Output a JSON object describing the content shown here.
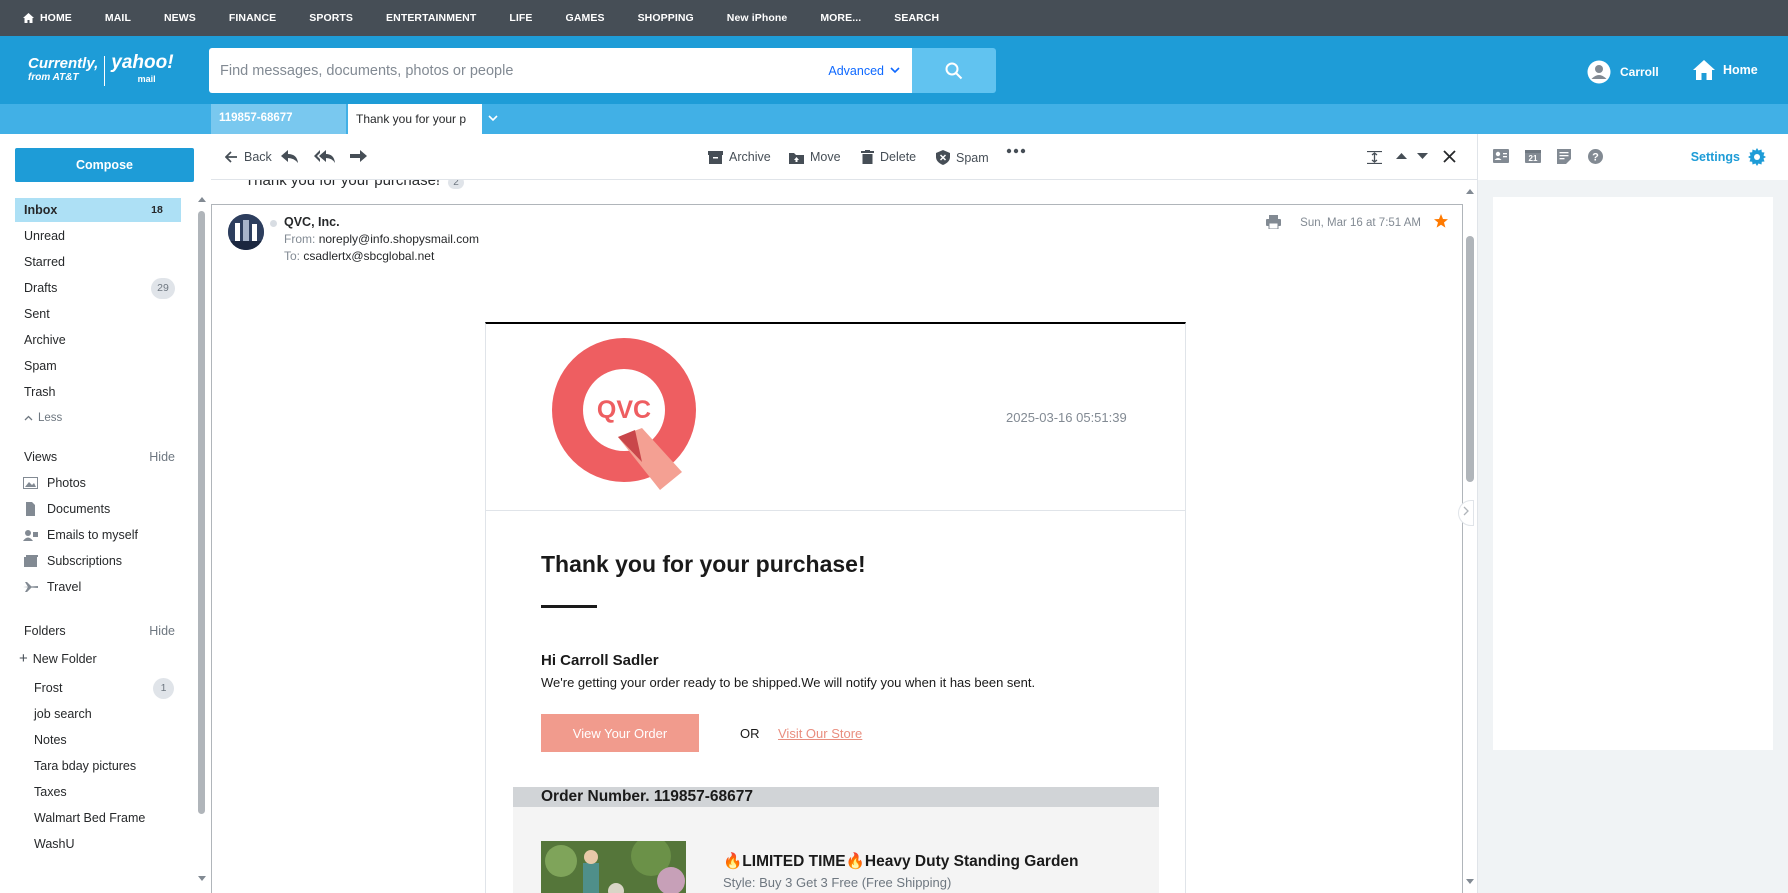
{
  "topnav": {
    "items": [
      "HOME",
      "MAIL",
      "NEWS",
      "FINANCE",
      "SPORTS",
      "ENTERTAINMENT",
      "LIFE",
      "GAMES",
      "SHOPPING",
      "New iPhone",
      "MORE...",
      "SEARCH"
    ]
  },
  "header": {
    "brand_currently": "Currently,",
    "brand_from": "from AT&T",
    "brand_yahoo": "yahoo!",
    "brand_mail": "mail",
    "search_placeholder": "Find messages, documents, photos or people",
    "advanced_label": "Advanced",
    "user_name": "Carroll",
    "home_label": "Home"
  },
  "tabs": {
    "tab1": "119857-68677",
    "tab2": "Thank you for your p"
  },
  "sidebar": {
    "compose": "Compose",
    "items": [
      {
        "label": "Inbox",
        "count": "18"
      },
      {
        "label": "Unread",
        "count": ""
      },
      {
        "label": "Starred",
        "count": ""
      },
      {
        "label": "Drafts",
        "count": "29"
      },
      {
        "label": "Sent",
        "count": ""
      },
      {
        "label": "Archive",
        "count": ""
      },
      {
        "label": "Spam",
        "count": ""
      },
      {
        "label": "Trash",
        "count": ""
      }
    ],
    "less": "Less",
    "views_label": "Views",
    "views_hide": "Hide",
    "views": [
      "Photos",
      "Documents",
      "Emails to myself",
      "Subscriptions",
      "Travel"
    ],
    "folders_label": "Folders",
    "folders_hide": "Hide",
    "new_folder": "New Folder",
    "folders": [
      {
        "label": "Frost",
        "count": "1"
      },
      {
        "label": "job search",
        "count": ""
      },
      {
        "label": "Notes",
        "count": ""
      },
      {
        "label": "Tara bday pictures",
        "count": ""
      },
      {
        "label": "Taxes",
        "count": ""
      },
      {
        "label": "Walmart Bed Frame",
        "count": ""
      },
      {
        "label": "WashU",
        "count": ""
      }
    ]
  },
  "toolbar": {
    "back": "Back",
    "archive": "Archive",
    "move": "Move",
    "delete": "Delete",
    "spam": "Spam"
  },
  "message": {
    "prev_subject": "Thank you for your purchase!",
    "prev_count": "2",
    "sender": "QVC, Inc.",
    "from_label": "From:",
    "from": "noreply@info.shopysmail.com",
    "to_label": "To:",
    "to": "csadlertx@sbcglobal.net",
    "date": "Sun, Mar 16 at 7:51 AM"
  },
  "email": {
    "logo_text": "QVC",
    "timestamp": "2025-03-16 05:51:39",
    "title": "Thank you for your purchase!",
    "greeting": "Hi Carroll Sadler",
    "body": "We're getting your order ready to be shipped.We will notify you when it has been sent.",
    "view_order": "View Your Order",
    "or": "OR",
    "visit_store": "Visit Our Store",
    "order_number": "Order Number. 119857-68677",
    "product_title": "🔥LIMITED TIME🔥Heavy Duty Standing Garden F",
    "product_style": "Style: Buy 3 Get 3 Free (Free Shipping)"
  },
  "rightpanel": {
    "settings": "Settings"
  },
  "colors": {
    "topnav_bg": "#464e56",
    "header_bg": "#1e9cd7",
    "accent": "#1e9cd7",
    "qvc_red": "#ee5e61",
    "button_salmon": "#f19b8d",
    "star": "#ff7a00"
  }
}
